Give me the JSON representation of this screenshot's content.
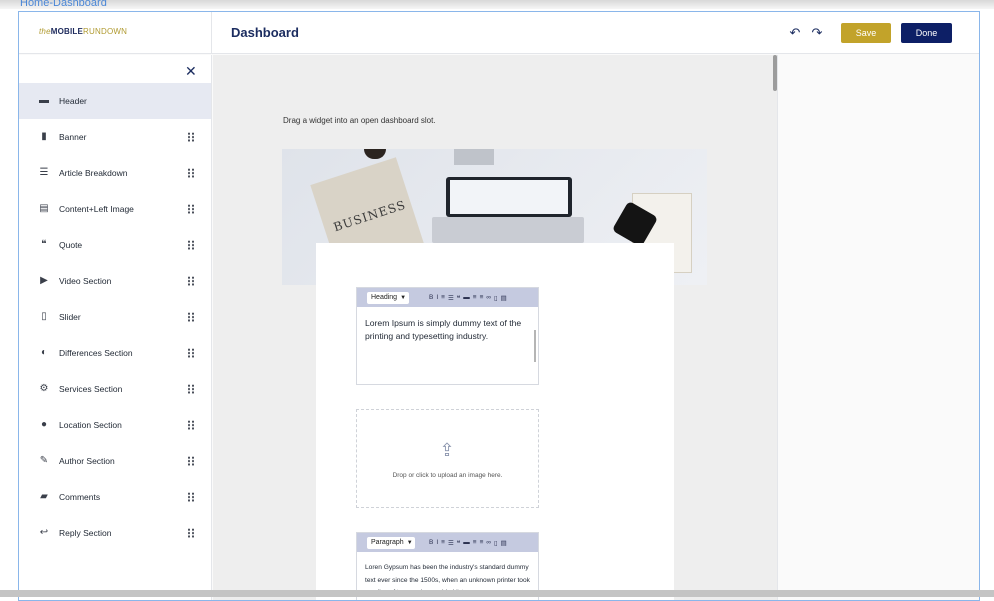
{
  "breadcrumb": "Home-Dashboard",
  "logo": {
    "prefix": "the",
    "bold": "MOBILE",
    "suffix": "RUNDOWN"
  },
  "header": {
    "title": "Dashboard",
    "save_label": "Save",
    "done_label": "Done"
  },
  "sidebar": {
    "items": [
      {
        "label": "Header",
        "icon": "header-icon"
      },
      {
        "label": "Banner",
        "icon": "banner-icon"
      },
      {
        "label": "Article Breakdown",
        "icon": "article-icon"
      },
      {
        "label": "Content+Left Image",
        "icon": "content-image-icon"
      },
      {
        "label": "Quote",
        "icon": "quote-icon"
      },
      {
        "label": "Video Section",
        "icon": "video-icon"
      },
      {
        "label": "Slider",
        "icon": "slider-icon"
      },
      {
        "label": "Differences Section",
        "icon": "toggle-icon"
      },
      {
        "label": "Services Section",
        "icon": "gears-icon"
      },
      {
        "label": "Location Section",
        "icon": "location-pin-icon"
      },
      {
        "label": "Author Section",
        "icon": "pencil-icon"
      },
      {
        "label": "Comments",
        "icon": "comments-icon"
      },
      {
        "label": "Reply Section",
        "icon": "reply-icon"
      }
    ]
  },
  "canvas": {
    "hint": "Drag a widget into an open dashboard slot.",
    "banner_text": "BUSINESS",
    "heading_editor": {
      "format": "Heading",
      "text": "Lorem Ipsum is simply dummy text of the printing and typesetting industry."
    },
    "upload": {
      "text": "Drop or click to upload an image here."
    },
    "paragraph_editor": {
      "format": "Paragraph",
      "text": "Loren Gypsum has been the industry's standard dummy text ever since the 1500s, when an unknown printer took a galley of type and scrambled it to"
    }
  }
}
